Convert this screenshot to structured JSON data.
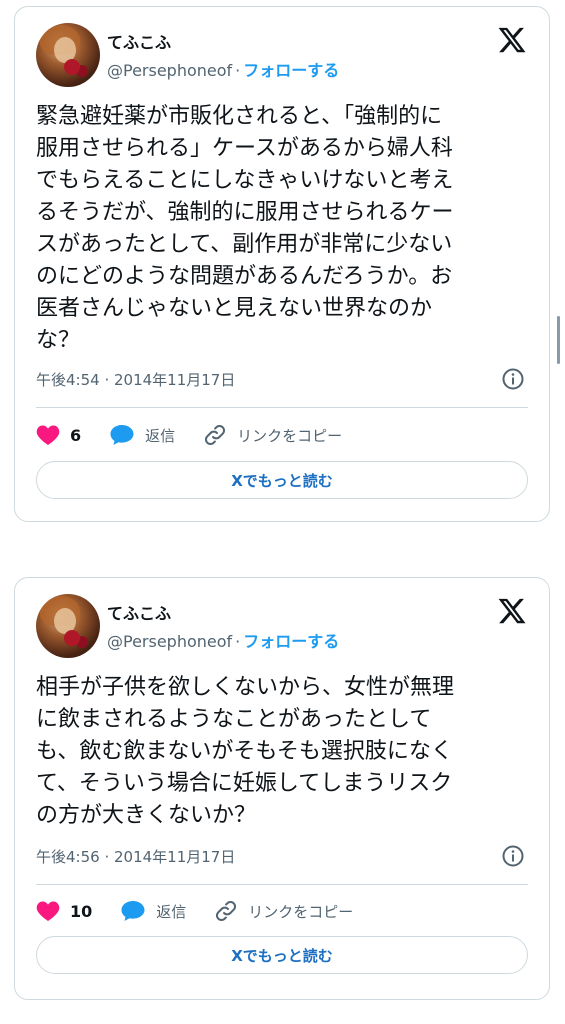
{
  "tweets": [
    {
      "author": {
        "name": "てふこふ",
        "handle": "@Persephoneof",
        "separator": "·",
        "follow_label": "フォローする"
      },
      "text": "緊急避妊薬が市販化されると、「強制的に\n服用させられる」ケースがあるから婦人科\nでもらえることにしなきゃいけないと考え\nるそうだが、強制的に服用させられるケー\nスがあったとして、副作用が非常に少ない\nのにどのような問題があるんだろうか。お\n医者さんじゃないと見えない世界なのか\nな？",
      "timestamp": "午後4:54 · 2014年11月17日",
      "likes": "6",
      "reply_label": "返信",
      "copy_link_label": "リンクをコピー",
      "read_more_label": "Xでもっと読む"
    },
    {
      "author": {
        "name": "てふこふ",
        "handle": "@Persephoneof",
        "separator": "·",
        "follow_label": "フォローする"
      },
      "text": "相手が子供を欲しくないから、女性が無理\nに飲まされるようなことがあったとして\nも、飲む飲まないがそもそも選択肢になく\nて、そういう場合に妊娠してしまうリスク\nの方が大きくないか？",
      "timestamp": "午後4:56 · 2014年11月17日",
      "likes": "10",
      "reply_label": "返信",
      "copy_link_label": "リンクをコピー",
      "read_more_label": "Xでもっと読む"
    }
  ],
  "icons": {
    "brand": "x-logo-icon",
    "info": "info-icon",
    "like": "heart-icon",
    "reply": "speech-bubble-icon",
    "copy": "link-icon"
  },
  "colors": {
    "like": "#f91880",
    "reply": "#1d9bf0",
    "link_text": "#1d9bf0",
    "muted": "#536471",
    "border": "#cfd9de"
  }
}
